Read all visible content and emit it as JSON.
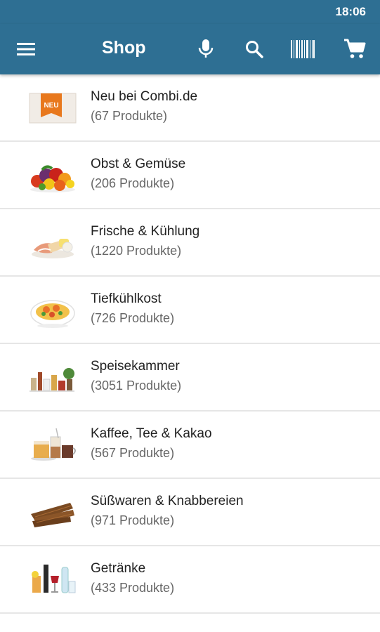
{
  "status_bar": {
    "time": "18:06"
  },
  "app_bar": {
    "title": "Shop",
    "icons": [
      "menu-icon",
      "microphone-icon",
      "search-icon",
      "barcode-icon",
      "cart-icon"
    ],
    "color": "#2e6f93"
  },
  "categories": [
    {
      "name": "Neu bei Combi.de",
      "count": "(67 Produkte)",
      "badge": "NEU",
      "icon": "neu-badge-image"
    },
    {
      "name": "Obst & Gemüse",
      "count": "(206 Produkte)",
      "icon": "fruit-vegetables-image"
    },
    {
      "name": "Frische & Kühlung",
      "count": "(1220 Produkte)",
      "icon": "fresh-chilled-image"
    },
    {
      "name": "Tiefkühlkost",
      "count": "(726 Produkte)",
      "icon": "frozen-food-image"
    },
    {
      "name": "Speisekammer",
      "count": "(3051 Produkte)",
      "icon": "pantry-image"
    },
    {
      "name": "Kaffee, Tee & Kakao",
      "count": "(567 Produkte)",
      "icon": "coffee-tea-image"
    },
    {
      "name": "Süßwaren & Knabbereien",
      "count": "(971 Produkte)",
      "icon": "sweets-snacks-image"
    },
    {
      "name": "Getränke",
      "count": "(433 Produkte)",
      "icon": "drinks-image"
    }
  ]
}
